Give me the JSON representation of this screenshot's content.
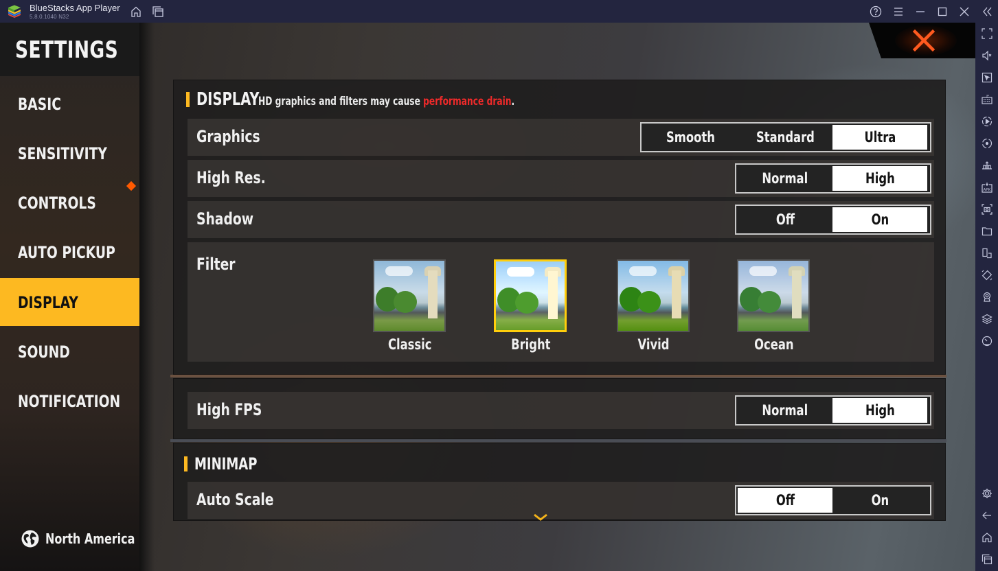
{
  "titlebar": {
    "app_name": "BlueStacks App Player",
    "version": "5.8.0.1040  N32",
    "icons": [
      "home-icon",
      "multi-instance-icon",
      "help-icon",
      "menu-icon",
      "minimize-icon",
      "maximize-icon",
      "close-icon",
      "collapse-sidebar-icon"
    ]
  },
  "side_toolbar": {
    "icons": [
      "fullscreen-icon",
      "volume-mute-icon",
      "pointer-icon",
      "keyboard-icon",
      "macro-play-icon",
      "rotate-sync-icon",
      "install-apk-icon",
      "apk-icon",
      "screenshot-icon",
      "folder-icon",
      "multi-window-icon",
      "shake-icon",
      "location-icon",
      "layers-icon",
      "performance-icon",
      "settings-icon",
      "back-icon",
      "home-icon",
      "recent-apps-icon"
    ]
  },
  "menu": {
    "title": "SETTINGS",
    "items": [
      {
        "label": "BASIC",
        "active": false
      },
      {
        "label": "SENSITIVITY",
        "active": false
      },
      {
        "label": "CONTROLS",
        "active": false,
        "notification": true
      },
      {
        "label": "AUTO PICKUP",
        "active": false
      },
      {
        "label": "DISPLAY",
        "active": true
      },
      {
        "label": "SOUND",
        "active": false
      },
      {
        "label": "NOTIFICATION",
        "active": false
      }
    ],
    "region": "North America"
  },
  "colors": {
    "accent": "#fdb921",
    "warning": "#f02a2a",
    "close": "#ff5a1f",
    "notify": "#ff5a00"
  },
  "display_section": {
    "title": "DISPLAY",
    "note_prefix": "HD graphics and filters may cause ",
    "note_warning": "performance drain",
    "note_suffix": ".",
    "settings": [
      {
        "label": "Graphics",
        "options": [
          "Smooth",
          "Standard",
          "Ultra"
        ],
        "selected": "Ultra"
      },
      {
        "label": "High Res.",
        "options": [
          "Normal",
          "High"
        ],
        "selected": "High"
      },
      {
        "label": "Shadow",
        "options": [
          "Off",
          "On"
        ],
        "selected": "On"
      }
    ],
    "filter": {
      "label": "Filter",
      "options": [
        "Classic",
        "Bright",
        "Vivid",
        "Ocean"
      ],
      "selected": "Bright"
    }
  },
  "fps_section": {
    "label": "High FPS",
    "options": [
      "Normal",
      "High"
    ],
    "selected": "High"
  },
  "minimap_section": {
    "title": "MINIMAP",
    "settings": [
      {
        "label": "Auto Scale",
        "options": [
          "Off",
          "On"
        ],
        "selected": "Off"
      }
    ]
  }
}
